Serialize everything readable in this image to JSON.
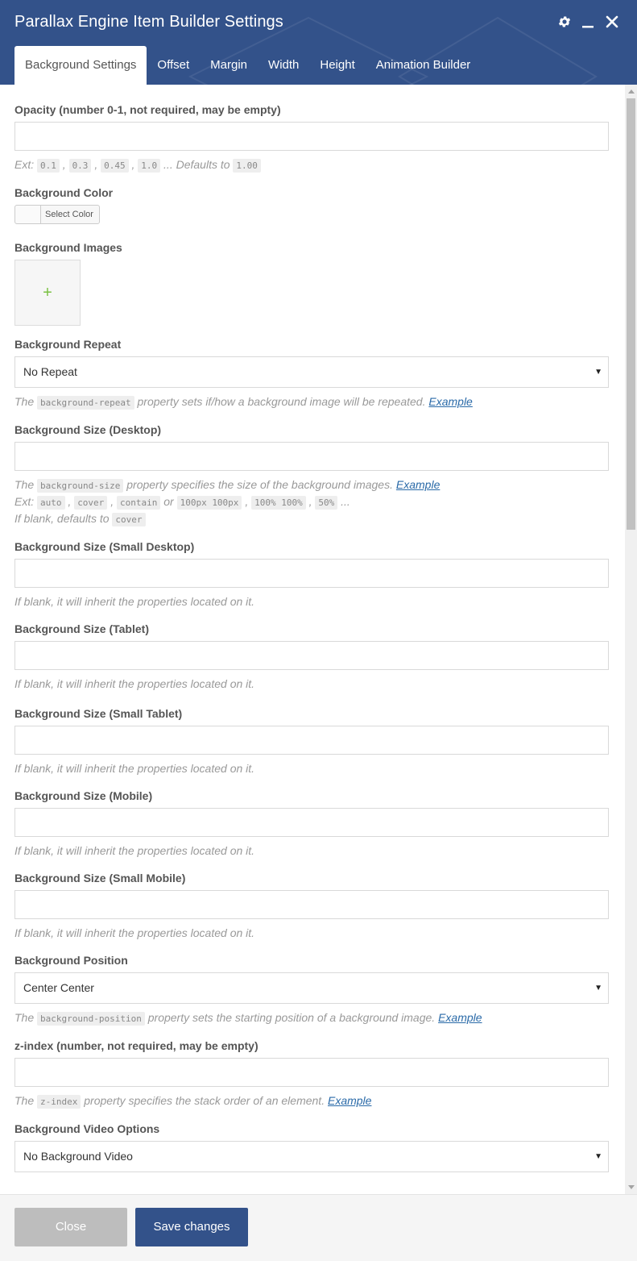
{
  "header": {
    "title": "Parallax Engine Item Builder Settings",
    "icons": {
      "settings": "gear-icon",
      "minimize": "minimize-icon",
      "close": "close-icon"
    },
    "colors": {
      "header_bg": "#33528a",
      "accent_green": "#7ac143",
      "link": "#2a6aa8"
    }
  },
  "tabs": [
    {
      "label": "Background Settings",
      "active": true
    },
    {
      "label": "Offset"
    },
    {
      "label": "Margin"
    },
    {
      "label": "Width"
    },
    {
      "label": "Height"
    },
    {
      "label": "Animation Builder"
    }
  ],
  "fields": {
    "opacity": {
      "label": "Opacity (number 0-1, not required, may be empty)",
      "value": "",
      "help_prefix": "Ext:",
      "examples": [
        "0.1",
        "0.3",
        "0.45",
        "1.0"
      ],
      "help_defaults": "... Defaults to",
      "default": "1.00"
    },
    "bg_color": {
      "label": "Background Color",
      "button_label": "Select Color"
    },
    "bg_images": {
      "label": "Background Images",
      "add_glyph": "+"
    },
    "bg_repeat": {
      "label": "Background Repeat",
      "value": "No Repeat",
      "help_before": "The",
      "help_code": "background-repeat",
      "help_after": "property sets if/how a background image will be repeated.",
      "link": "Example"
    },
    "bg_size_desktop": {
      "label": "Background Size (Desktop)",
      "value": "",
      "help_before": "The",
      "help_code": "background-size",
      "help_after": "property specifies the size of the background images.",
      "link": "Example",
      "ext_label": "Ext:",
      "ext_values": [
        "auto",
        "cover",
        "contain",
        "100px 100px",
        "100% 100%",
        "50%"
      ],
      "ext_or": "or",
      "ext_tail": "...",
      "blank_text": "If blank, defaults to",
      "blank_default": "cover"
    },
    "bg_size_small_desktop": {
      "label": "Background Size (Small Desktop)",
      "value": "",
      "help": "If blank, it will inherit the properties located on it."
    },
    "bg_size_tablet": {
      "label": "Background Size (Tablet)",
      "value": "",
      "help": "If blank, it will inherit the properties located on it."
    },
    "bg_size_small_tablet": {
      "label": "Background Size (Small Tablet)",
      "value": "",
      "help": "If blank, it will inherit the properties located on it."
    },
    "bg_size_mobile": {
      "label": "Background Size (Mobile)",
      "value": "",
      "help": "If blank, it will inherit the properties located on it."
    },
    "bg_size_small_mobile": {
      "label": "Background Size (Small Mobile)",
      "value": "",
      "help": "If blank, it will inherit the properties located on it."
    },
    "bg_position": {
      "label": "Background Position",
      "value": "Center Center",
      "help_before": "The",
      "help_code": "background-position",
      "help_after": "property sets the starting position of a background image.",
      "link": "Example"
    },
    "z_index": {
      "label": "z-index (number, not required, may be empty)",
      "value": "",
      "help_before": "The",
      "help_code": "z-index",
      "help_after": "property specifies the stack order of an element.",
      "link": "Example"
    },
    "bg_video": {
      "label": "Background Video Options",
      "value": "No Background Video"
    }
  },
  "footer": {
    "close_label": "Close",
    "save_label": "Save changes"
  }
}
